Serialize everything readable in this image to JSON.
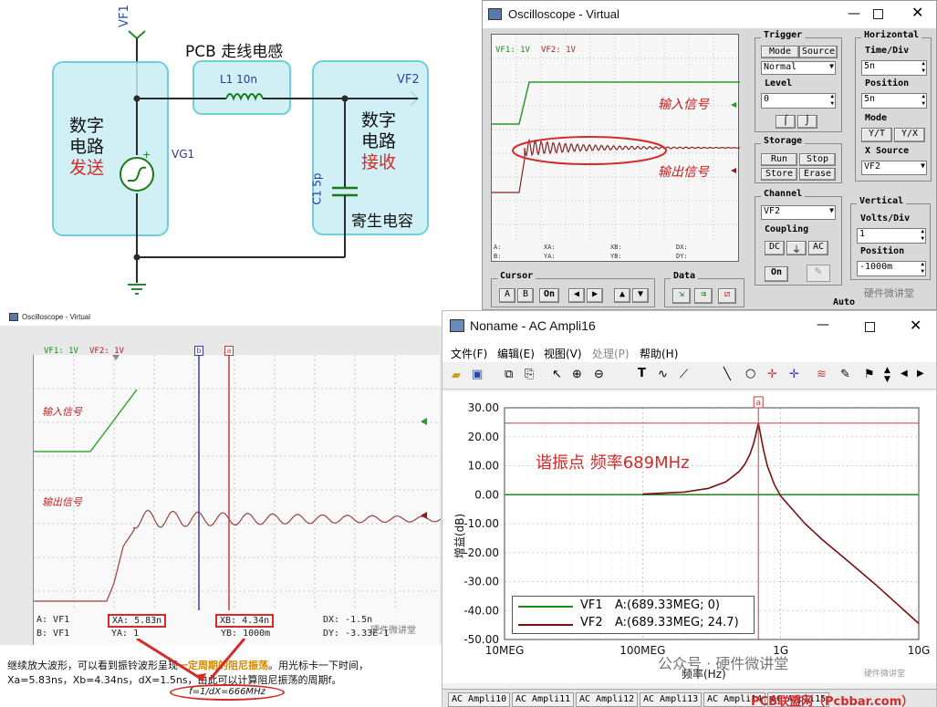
{
  "schematic": {
    "title": "PCB 走线电感",
    "vf1": "VF1",
    "vf2": "VF2",
    "inductor": "L1 10n",
    "capacitor": "C1 5p",
    "vg1": "VG1",
    "plus": "+",
    "sender": [
      "数字",
      "电路",
      "发送"
    ],
    "receiver": [
      "数字",
      "电路",
      "接收"
    ],
    "parasitic": "寄生电容"
  },
  "osc1": {
    "title": "Oscilloscope - Virtual",
    "legend_vf1": "VF1: 1V",
    "legend_vf2": "VF2: 1V",
    "annot_input": "输入信号",
    "annot_output": "输出信号",
    "readout": {
      "a": "A:",
      "b": "B:",
      "xa": "XA:",
      "ya": "YA:",
      "xb": "XB:",
      "yb": "YB:",
      "dx": "DX:",
      "dy": "DY:"
    },
    "trigger": {
      "label": "Trigger",
      "mode": "Mode",
      "source": "Source",
      "mode_value": "Normal",
      "level": "Level",
      "level_value": "0"
    },
    "horizontal": {
      "label": "Horizontal",
      "time_div": "Time/Div",
      "time_value": "5n",
      "position": "Position",
      "position_value": "5n",
      "mode": "Mode",
      "yt": "Y/T",
      "yx": "Y/X",
      "xsource": "X Source",
      "xsource_value": "VF2"
    },
    "storage": {
      "label": "Storage",
      "run": "Run",
      "stop": "Stop",
      "store": "Store",
      "erase": "Erase"
    },
    "channel": {
      "label": "Channel",
      "value": "VF2",
      "coupling": "Coupling",
      "dc": "DC",
      "gnd": "⏚",
      "ac": "AC",
      "on": "On"
    },
    "vertical": {
      "label": "Vertical",
      "volts_div": "Volts/Div",
      "volts_value": "1",
      "position": "Position",
      "position_value": "-1000m"
    },
    "cursor": {
      "label": "Cursor",
      "a": "A",
      "b": "B",
      "on": "On"
    },
    "data": {
      "label": "Data"
    },
    "auto": "Auto",
    "watermark": "硬件微讲堂"
  },
  "osc2": {
    "title": "Oscilloscope - Virtual",
    "legend_vf1": "VF1: 1V",
    "legend_vf2": "VF2: 1V",
    "annot_input": "输入信号",
    "annot_output": "输出信号",
    "cursor_a": "a",
    "cursor_b": "b",
    "readout": {
      "a": "A: VF1",
      "b": "B: VF1",
      "xa": "XA: 5.83n",
      "ya": "YA: 1",
      "xb": "XB: 4.34n",
      "yb": "YB: 1000m",
      "dx": "DX: -1.5n",
      "dy": "DY: -3.33E-1"
    },
    "watermark": "硬件微讲堂"
  },
  "caption": {
    "line1a": "继续放大波形，可以看到振铃波形呈现",
    "line1b": "一定周期的阻尼振荡",
    "line1c": "。用光标卡一下时间，",
    "line2": "Xa=5.83ns，Xb=4.34ns，dX=1.5ns，由此可以计算阻尼振荡的周期f。",
    "formula": "f=1/dX=666MHz"
  },
  "ac": {
    "title": "Noname - AC Ampli16",
    "menu": [
      "文件(F)",
      "编辑(E)",
      "视图(V)",
      "处理(P)",
      "帮助(H)"
    ],
    "annotation": "谐振点 频率689MHz",
    "ylabel": "增益(dB)",
    "xlabel": "频率(Hz)",
    "cursor_a": "a",
    "legend": [
      {
        "name": "VF1",
        "text": "A:(689.33MEG; 0)",
        "color": "#1a8a1a"
      },
      {
        "name": "VF2",
        "text": "A:(689.33MEG; 24.7)",
        "color": "#7a1010"
      }
    ],
    "tabs": [
      "AC Ampli10",
      "AC Ampli11",
      "AC Ampli12",
      "AC Ampli13",
      "AC Ampli14",
      "AC Ampli15"
    ],
    "watermark1": "公众号 · 硬件微讲堂",
    "watermark2": "PCB联盟网（Pcbbar.com）",
    "watermark3": "硬件微讲堂"
  },
  "chart_data": {
    "type": "line",
    "xscale": "log",
    "xlim": [
      10000000,
      10000000000
    ],
    "ylim": [
      -50,
      30
    ],
    "x_ticks": [
      "10MEG",
      "100MEG",
      "1G",
      "10G"
    ],
    "y_ticks": [
      "30.00",
      "20.00",
      "10.00",
      "0.00",
      "-10.00",
      "-20.00",
      "-30.00",
      "-40.00",
      "-50.00"
    ],
    "xlabel": "频率(Hz)",
    "ylabel": "增益(dB)",
    "series": [
      {
        "name": "VF1",
        "x": [
          10000000,
          10000000000
        ],
        "y": [
          0,
          0
        ]
      },
      {
        "name": "VF2",
        "x": [
          100000000,
          200000000,
          300000000,
          400000000,
          500000000,
          550000000,
          600000000,
          640000000,
          670000000,
          689330000,
          710000000,
          750000000,
          800000000,
          900000000,
          1000000000,
          1500000000,
          2000000000,
          3000000000,
          5000000000,
          10000000000
        ],
        "y": [
          0.2,
          0.9,
          2.2,
          4.4,
          8.0,
          10.5,
          14.0,
          18.0,
          22.0,
          24.7,
          21.5,
          15.5,
          10.0,
          3.5,
          -0.5,
          -10.0,
          -15.5,
          -22.5,
          -31.5,
          -44.5
        ]
      }
    ],
    "cursor_x": 689330000,
    "marker_y": 24.7
  }
}
